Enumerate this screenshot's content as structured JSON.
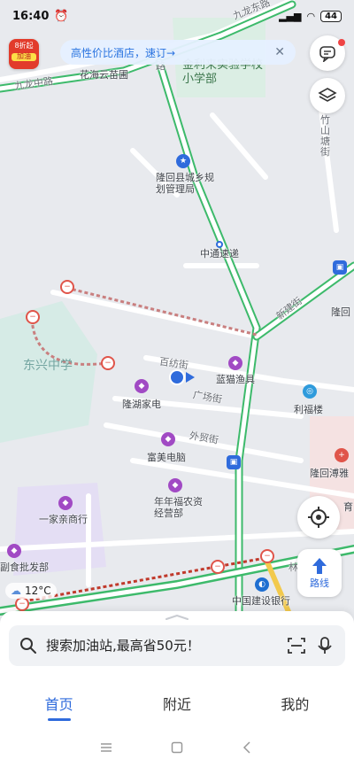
{
  "status": {
    "time": "16:40",
    "battery": "44"
  },
  "promo": {
    "line1": "8折起",
    "line2": "加油"
  },
  "banner": {
    "text": "高性价比酒店，速订→"
  },
  "map": {
    "labels": {
      "jiulong_east": "九龙东路",
      "jiulong_middle": "九龙中路",
      "huahai": "花海云苗圃",
      "lu": "路",
      "jinli_school": "金利来实验学校小学部",
      "zhushan": "竹山塘街",
      "planning_bureau": "隆回县城乡规划管理局",
      "zhongtong": "中通速递",
      "xinjian": "新建街",
      "longhui_right": "隆回",
      "dongxing": "东兴中学",
      "baifang": "百纺街",
      "lanmao": "蓝猫渔具",
      "guangchang": "广场街",
      "lifu": "利福楼",
      "longhu": "隆湖家电",
      "waimao": "外贸街",
      "fumei": "富美电脑",
      "boya": "隆回溥雅",
      "yu": "育",
      "nian": "年年福农资经营部",
      "yijiaqin": "一家亲商行",
      "fushi": "副食批发部",
      "lin": "林",
      "ccb": "中国建设银行"
    }
  },
  "weather": {
    "temp": "12°C"
  },
  "controls": {
    "route_label": "路线"
  },
  "search": {
    "placeholder": "搜索加油站,最高省50元！"
  },
  "tabs": [
    {
      "label": "首页"
    },
    {
      "label": "附近"
    },
    {
      "label": "我的"
    }
  ]
}
